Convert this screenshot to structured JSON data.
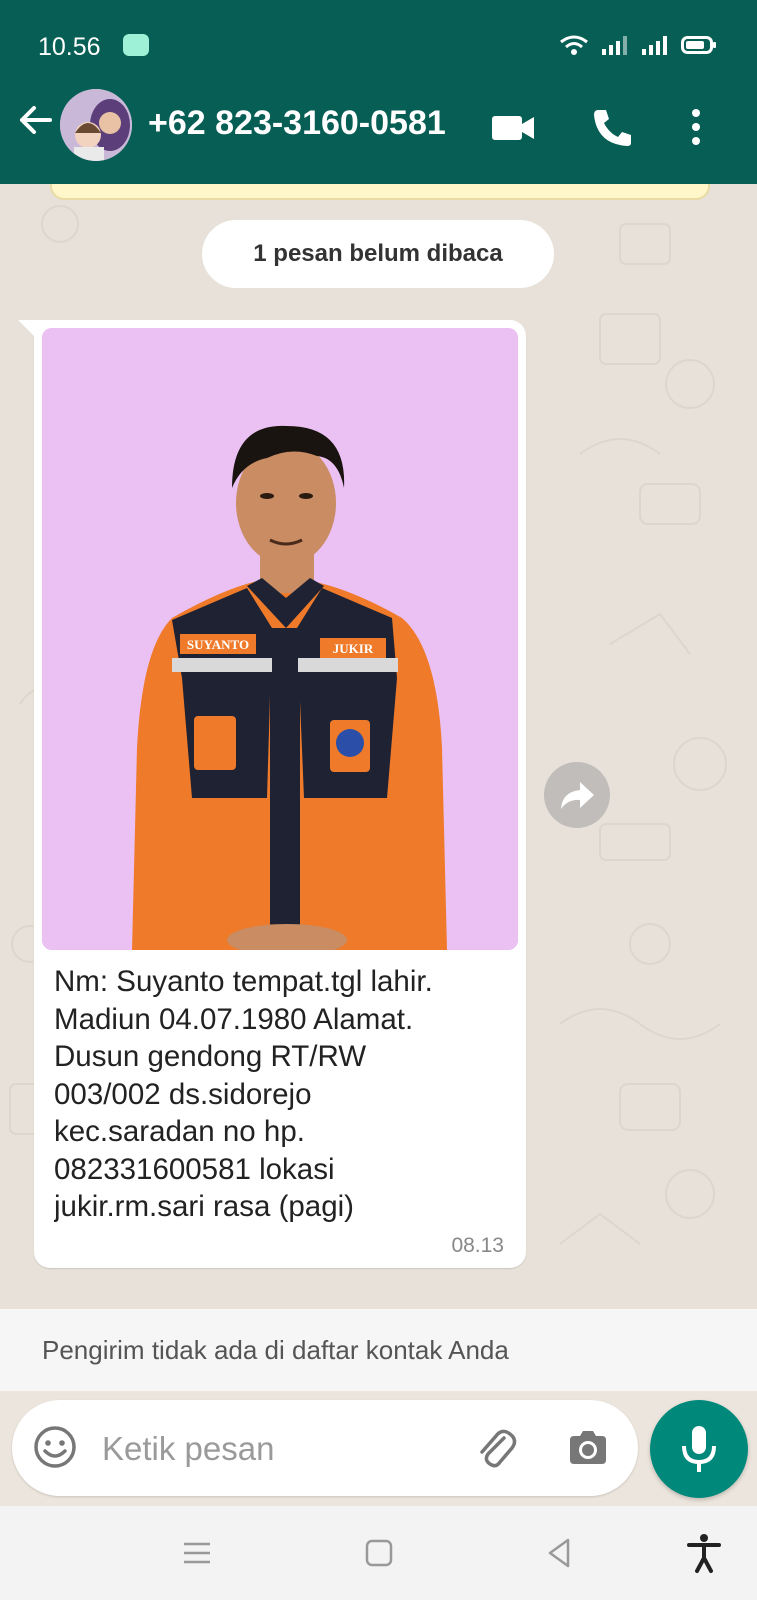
{
  "status_bar": {
    "time": "10.56"
  },
  "header": {
    "contact_name": "+62 823-3160-0581",
    "icons": [
      "back-arrow-icon",
      "avatar",
      "video-call-icon",
      "voice-call-icon",
      "more-options-icon"
    ]
  },
  "chat": {
    "unread_banner": "1 pesan belum dibaca",
    "message": {
      "text": "Nm: Suyanto  tempat.tgl lahir.\nMadiun 04.07.1980 Alamat.\nDusun gendong RT/RW\n003/002 ds.sidorejo\nkec.saradan no hp.\n082331600581 lokasi\njukir.rm.sari rasa (pagi)",
      "time": "08.13",
      "photo_badges": {
        "name_patch": "SUYANTO",
        "role_patch": "JUKIR"
      }
    }
  },
  "notice": {
    "text": "Pengirim tidak ada di daftar kontak Anda"
  },
  "composer": {
    "placeholder": "Ketik pesan"
  },
  "colors": {
    "header": "#075e54",
    "accent": "#00897b",
    "chat_bg": "#e7e1d9",
    "photo_bg": "#e4b6ef",
    "jacket": "#ef7a2a"
  }
}
